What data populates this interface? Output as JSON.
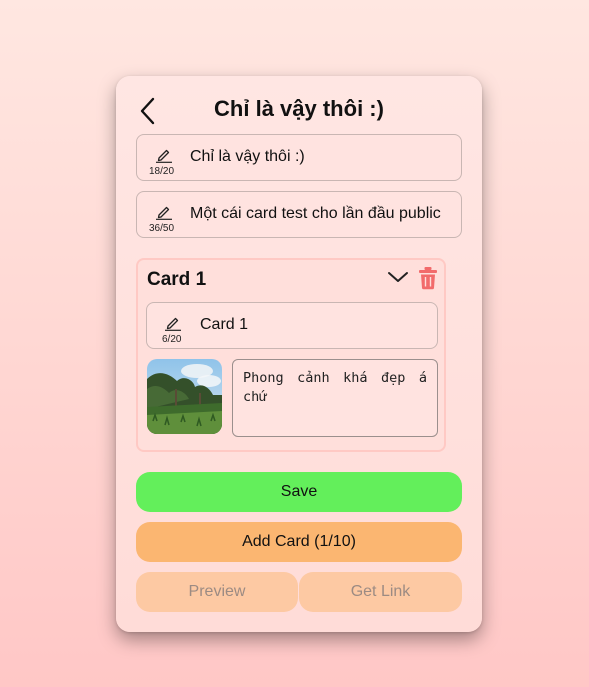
{
  "header": {
    "title": "Chỉ là vậy thôi :)"
  },
  "fields": {
    "name": {
      "value": "Chỉ là vậy thôi :)",
      "counter": "18/20"
    },
    "description": {
      "value": "Một cái card test cho lần đầu public",
      "counter": "36/50"
    }
  },
  "card": {
    "title": "Card 1",
    "name_field": {
      "value": "Card 1",
      "counter": "6/20"
    },
    "caption": "Phong cảnh khá đẹp á chứ"
  },
  "buttons": {
    "save": "Save",
    "add_card": "Add Card (1/10)",
    "preview": "Preview",
    "get_link": "Get Link"
  },
  "colors": {
    "save": "#63ef5b",
    "add_card": "#fbb671",
    "disabled": "#fdc9a3",
    "trash": "#f26b6b"
  },
  "icons": {
    "back": "chevron-left-icon",
    "edit": "pencil-icon",
    "collapse": "chevron-down-icon",
    "delete": "trash-icon"
  }
}
